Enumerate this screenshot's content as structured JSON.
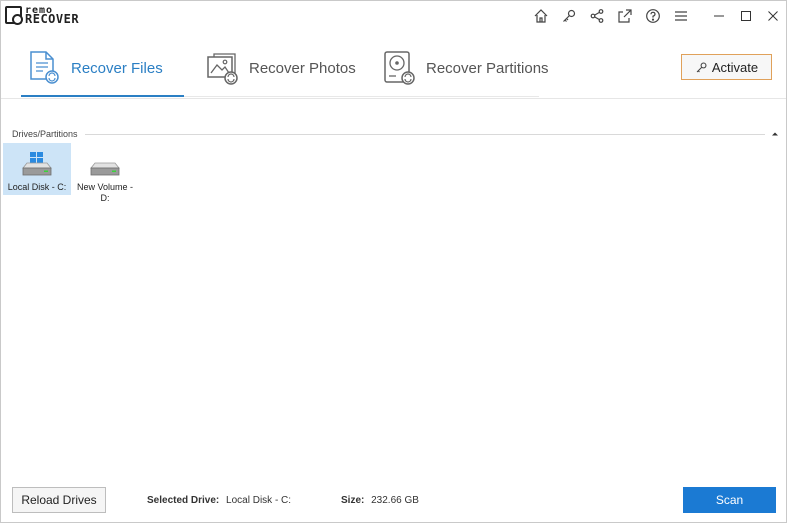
{
  "app": {
    "logo_top": "remo",
    "logo_bottom": "RECOVER"
  },
  "toolbar": {
    "icons": [
      "home-icon",
      "key-icon",
      "share-icon",
      "external-link-icon",
      "help-icon",
      "menu-icon"
    ],
    "window_controls": [
      "minimize-icon",
      "maximize-icon",
      "close-icon"
    ]
  },
  "tabs": [
    {
      "label": "Recover Files",
      "icon": "recover-files-icon",
      "active": true
    },
    {
      "label": "Recover Photos",
      "icon": "recover-photos-icon",
      "active": false
    },
    {
      "label": "Recover Partitions",
      "icon": "recover-partitions-icon",
      "active": false
    }
  ],
  "activate_label": "Activate",
  "drives_section": {
    "title": "Drives/Partitions",
    "drives": [
      {
        "label": "Local Disk - C:",
        "icon": "windows-drive-icon",
        "selected": true
      },
      {
        "label": "New Volume - D:",
        "icon": "drive-icon",
        "selected": false
      }
    ]
  },
  "footer": {
    "reload_label": "Reload Drives",
    "selected_drive_label": "Selected Drive:",
    "selected_drive_value": "Local Disk - C:",
    "size_label": "Size:",
    "size_value": "232.66 GB",
    "scan_label": "Scan"
  },
  "colors": {
    "accent": "#2b7fc4",
    "scan_button": "#1b7ad3",
    "activate_border": "#e0a15a",
    "selected_drive_bg": "#cde4f7"
  }
}
